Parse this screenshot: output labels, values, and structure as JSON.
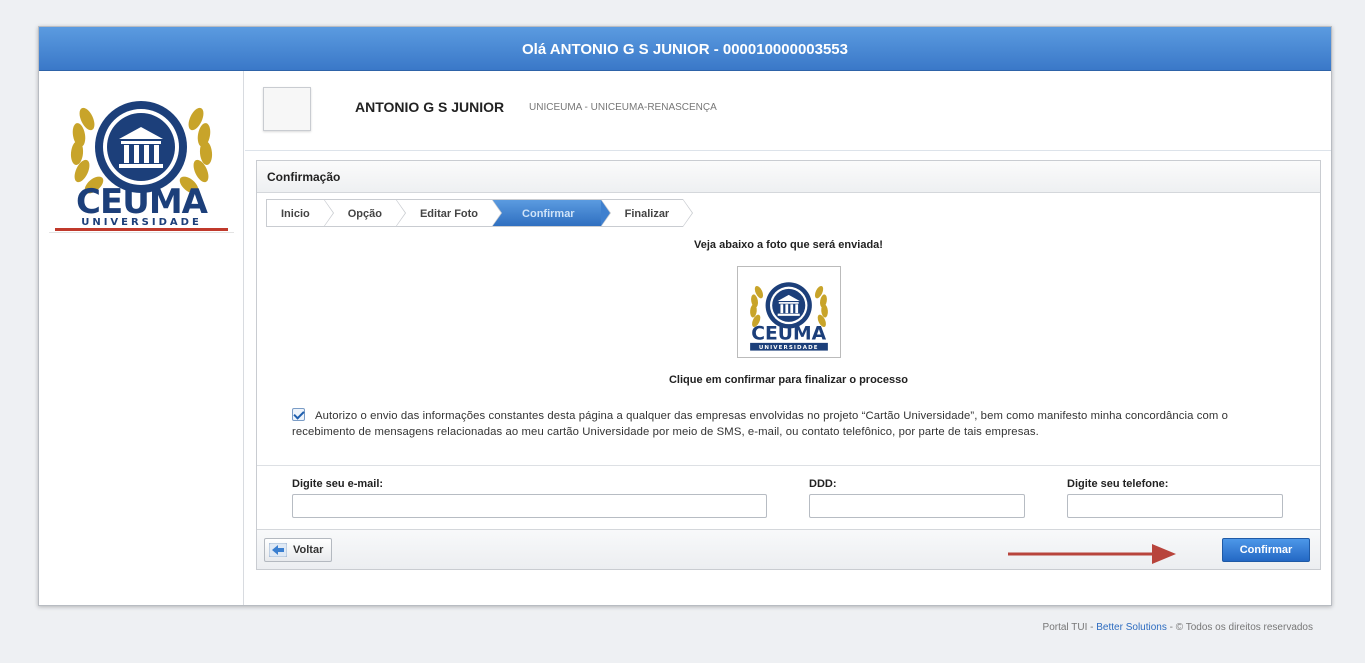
{
  "header": {
    "greeting": "Olá ANTONIO G S JUNIOR - 000010000003553"
  },
  "logo": {
    "brand": "CEUMA",
    "subtitle": "UNIVERSIDADE"
  },
  "user": {
    "name": "ANTONIO G S JUNIOR",
    "institution": "UNICEUMA - UNICEUMA-RENASCENÇA"
  },
  "panel": {
    "title": "Confirmação",
    "steps": [
      {
        "label": "Inicio",
        "active": false
      },
      {
        "label": "Opção",
        "active": false
      },
      {
        "label": "Editar Foto",
        "active": false
      },
      {
        "label": "Confirmar",
        "active": true
      },
      {
        "label": "Finalizar",
        "active": false
      }
    ],
    "photo_caption": "Veja abaixo a foto que será enviada!",
    "finish_caption": "Clique em confirmar para finalizar o processo",
    "consent_checked": true,
    "consent_text": "Autorizo o envio das informações constantes desta página a qualquer das empresas envolvidas no projeto “Cartão Universidade”, bem como manifesto minha concordância com o  recebimento de mensagens relacionadas ao meu cartão Universidade por meio de SMS, e-mail, ou  contato telefônico,  por parte de tais empresas."
  },
  "form": {
    "email_label": "Digite seu e-mail:",
    "email_value": "",
    "ddd_label": "DDD:",
    "ddd_value": "",
    "phone_label": "Digite seu telefone:",
    "phone_value": ""
  },
  "actions": {
    "back_label": "Voltar",
    "confirm_label": "Confirmar"
  },
  "footer": {
    "prefix": "Portal TUI - ",
    "link": "Better Solutions",
    "suffix": " - © Todos os direitos reservados"
  },
  "colors": {
    "accent": "#3a78c8",
    "annotation_arrow": "#b8443c"
  }
}
